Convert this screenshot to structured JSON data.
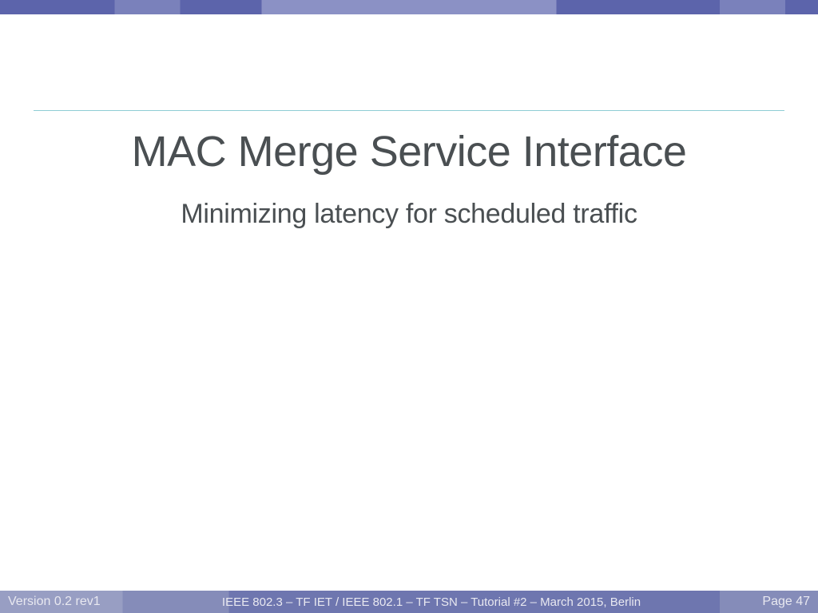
{
  "slide": {
    "title": "MAC Merge Service Interface",
    "subtitle": "Minimizing latency for scheduled traffic"
  },
  "footer": {
    "version": "Version 0.2 rev1",
    "center": "IEEE 802.3 – TF IET / IEEE 802.1 – TF TSN – Tutorial #2 – March 2015, Berlin",
    "page": "Page 47"
  }
}
